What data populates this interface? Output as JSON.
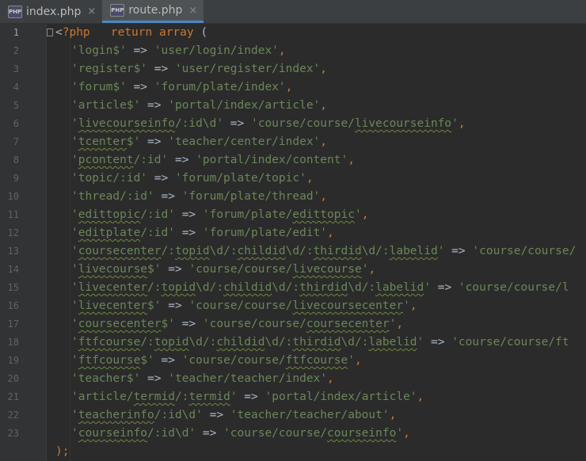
{
  "tabs": [
    {
      "label": "index.php",
      "active": false,
      "icon": "php-file-icon",
      "close": "×"
    },
    {
      "label": "route.php",
      "active": true,
      "icon": "php-file-icon",
      "close": "×"
    }
  ],
  "colors": {
    "keyword": "#cc7832",
    "string": "#6a8759",
    "text": "#a9b7c6",
    "background": "#2b2b2b"
  },
  "lines": [
    {
      "n": "1",
      "html": [
        [
          "t",
          "<"
        ],
        [
          "k",
          "?php"
        ],
        [
          "t",
          "   "
        ],
        [
          "k",
          "return array"
        ],
        [
          "t",
          " ("
        ]
      ]
    },
    {
      "n": "2",
      "html": [
        [
          "s",
          "'login$'"
        ],
        [
          "t",
          " => "
        ],
        [
          "s",
          "'user/login/index'"
        ],
        [
          "k",
          ","
        ]
      ]
    },
    {
      "n": "3",
      "html": [
        [
          "s",
          "'register$'"
        ],
        [
          "t",
          " => "
        ],
        [
          "s",
          "'user/register/index'"
        ],
        [
          "k",
          ","
        ]
      ]
    },
    {
      "n": "4",
      "html": [
        [
          "s",
          "'forum$'"
        ],
        [
          "t",
          " => "
        ],
        [
          "s",
          "'forum/plate/index'"
        ],
        [
          "k",
          ","
        ]
      ]
    },
    {
      "n": "5",
      "html": [
        [
          "s",
          "'article$'"
        ],
        [
          "t",
          " => "
        ],
        [
          "s",
          "'portal/index/article'"
        ],
        [
          "k",
          ","
        ]
      ]
    },
    {
      "n": "6",
      "html": [
        [
          "s",
          "'"
        ],
        [
          "su",
          "livecourseinfo"
        ],
        [
          "s",
          "/:id\\d'"
        ],
        [
          "t",
          " => "
        ],
        [
          "s",
          "'course/course/"
        ],
        [
          "su",
          "livecourseinfo"
        ],
        [
          "s",
          "'"
        ],
        [
          "k",
          ","
        ]
      ]
    },
    {
      "n": "7",
      "html": [
        [
          "s",
          "'"
        ],
        [
          "su",
          "tcenter"
        ],
        [
          "s",
          "$'"
        ],
        [
          "t",
          " => "
        ],
        [
          "s",
          "'teacher/center/index'"
        ],
        [
          "k",
          ","
        ]
      ]
    },
    {
      "n": "8",
      "html": [
        [
          "s",
          "'"
        ],
        [
          "su",
          "pcontent"
        ],
        [
          "s",
          "/:id'"
        ],
        [
          "t",
          " => "
        ],
        [
          "s",
          "'portal/index/content'"
        ],
        [
          "k",
          ","
        ]
      ]
    },
    {
      "n": "9",
      "html": [
        [
          "s",
          "'topic/:id'"
        ],
        [
          "t",
          " => "
        ],
        [
          "s",
          "'forum/plate/topic'"
        ],
        [
          "k",
          ","
        ]
      ]
    },
    {
      "n": "10",
      "html": [
        [
          "s",
          "'thread/:id'"
        ],
        [
          "t",
          " => "
        ],
        [
          "s",
          "'forum/plate/thread'"
        ],
        [
          "k",
          ","
        ]
      ]
    },
    {
      "n": "11",
      "html": [
        [
          "s",
          "'"
        ],
        [
          "su",
          "edittopic"
        ],
        [
          "s",
          "/:id'"
        ],
        [
          "t",
          " => "
        ],
        [
          "s",
          "'forum/plate/"
        ],
        [
          "su",
          "edittopic"
        ],
        [
          "s",
          "'"
        ],
        [
          "k",
          ","
        ]
      ]
    },
    {
      "n": "12",
      "html": [
        [
          "s",
          "'"
        ],
        [
          "su",
          "editplate"
        ],
        [
          "s",
          "/:id'"
        ],
        [
          "t",
          " => "
        ],
        [
          "s",
          "'forum/plate/edit'"
        ],
        [
          "k",
          ","
        ]
      ]
    },
    {
      "n": "13",
      "html": [
        [
          "s",
          "'"
        ],
        [
          "su",
          "coursecenter"
        ],
        [
          "s",
          "/:"
        ],
        [
          "su",
          "topid"
        ],
        [
          "s",
          "\\d/:"
        ],
        [
          "su",
          "childid"
        ],
        [
          "s",
          "\\d/:"
        ],
        [
          "su",
          "thirdid"
        ],
        [
          "s",
          "\\d/:"
        ],
        [
          "su",
          "labelid"
        ],
        [
          "s",
          "'"
        ],
        [
          "t",
          " => "
        ],
        [
          "s",
          "'course/course/"
        ]
      ]
    },
    {
      "n": "14",
      "html": [
        [
          "s",
          "'"
        ],
        [
          "su",
          "livecourse"
        ],
        [
          "s",
          "$'"
        ],
        [
          "t",
          " => "
        ],
        [
          "s",
          "'course/course/"
        ],
        [
          "su",
          "livecourse"
        ],
        [
          "s",
          "'"
        ],
        [
          "k",
          ","
        ]
      ]
    },
    {
      "n": "15",
      "html": [
        [
          "s",
          "'"
        ],
        [
          "su",
          "livecenter"
        ],
        [
          "s",
          "/:"
        ],
        [
          "su",
          "topid"
        ],
        [
          "s",
          "\\d/:"
        ],
        [
          "su",
          "childid"
        ],
        [
          "s",
          "\\d/:"
        ],
        [
          "su",
          "thirdid"
        ],
        [
          "s",
          "\\d/:"
        ],
        [
          "su",
          "labelid"
        ],
        [
          "s",
          "'"
        ],
        [
          "t",
          " => "
        ],
        [
          "s",
          "'course/course/l"
        ]
      ]
    },
    {
      "n": "16",
      "html": [
        [
          "s",
          "'"
        ],
        [
          "su",
          "livecenter"
        ],
        [
          "s",
          "$'"
        ],
        [
          "t",
          " => "
        ],
        [
          "s",
          "'course/course/"
        ],
        [
          "su",
          "livecoursecenter"
        ],
        [
          "s",
          "'"
        ],
        [
          "k",
          ","
        ]
      ]
    },
    {
      "n": "17",
      "html": [
        [
          "s",
          "'"
        ],
        [
          "su",
          "coursecenter"
        ],
        [
          "s",
          "$'"
        ],
        [
          "t",
          " => "
        ],
        [
          "s",
          "'course/course/"
        ],
        [
          "su",
          "coursecenter"
        ],
        [
          "s",
          "'"
        ],
        [
          "k",
          ","
        ]
      ]
    },
    {
      "n": "18",
      "html": [
        [
          "s",
          "'"
        ],
        [
          "su",
          "ftfcourse"
        ],
        [
          "s",
          "/:"
        ],
        [
          "su",
          "topid"
        ],
        [
          "s",
          "\\d/:"
        ],
        [
          "su",
          "childid"
        ],
        [
          "s",
          "\\d/:"
        ],
        [
          "su",
          "thirdid"
        ],
        [
          "s",
          "\\d/:"
        ],
        [
          "su",
          "labelid"
        ],
        [
          "s",
          "'"
        ],
        [
          "t",
          " => "
        ],
        [
          "s",
          "'course/course/ft"
        ]
      ]
    },
    {
      "n": "19",
      "html": [
        [
          "s",
          "'"
        ],
        [
          "su",
          "ftfcourse"
        ],
        [
          "s",
          "$'"
        ],
        [
          "t",
          " => "
        ],
        [
          "s",
          "'course/course/"
        ],
        [
          "su",
          "ftfcourse"
        ],
        [
          "s",
          "'"
        ],
        [
          "k",
          ","
        ]
      ]
    },
    {
      "n": "20",
      "html": [
        [
          "s",
          "'teacher$'"
        ],
        [
          "t",
          " => "
        ],
        [
          "s",
          "'teacher/teacher/index'"
        ],
        [
          "k",
          ","
        ]
      ]
    },
    {
      "n": "21",
      "html": [
        [
          "s",
          "'article/"
        ],
        [
          "su",
          "termid"
        ],
        [
          "s",
          "/:"
        ],
        [
          "su",
          "termid"
        ],
        [
          "s",
          "'"
        ],
        [
          "t",
          " => "
        ],
        [
          "s",
          "'portal/index/article'"
        ],
        [
          "k",
          ","
        ]
      ]
    },
    {
      "n": "22",
      "html": [
        [
          "s",
          "'"
        ],
        [
          "su",
          "teacherinfo"
        ],
        [
          "s",
          "/:id\\d'"
        ],
        [
          "t",
          " => "
        ],
        [
          "s",
          "'teacher/teacher/about'"
        ],
        [
          "k",
          ","
        ]
      ]
    },
    {
      "n": "23",
      "html": [
        [
          "s",
          "'"
        ],
        [
          "su",
          "courseinfo"
        ],
        [
          "s",
          "/:id\\d'"
        ],
        [
          "t",
          " => "
        ],
        [
          "s",
          "'course/course/"
        ],
        [
          "su",
          "courseinfo"
        ],
        [
          "s",
          "'"
        ],
        [
          "k",
          ","
        ]
      ]
    },
    {
      "n": "",
      "html": [
        [
          "k",
          ");"
        ]
      ]
    }
  ]
}
